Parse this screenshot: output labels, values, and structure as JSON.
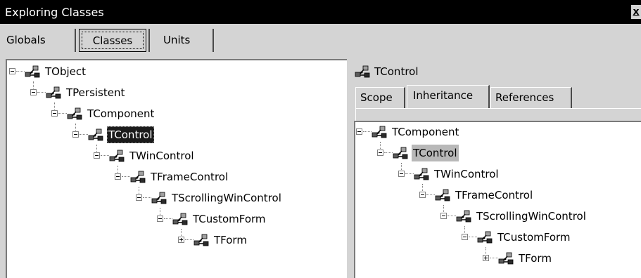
{
  "window": {
    "title": "Exploring Classes",
    "close_label": "x"
  },
  "main_tabs": [
    {
      "label": "Globals"
    },
    {
      "label": "Classes"
    },
    {
      "label": "Units"
    }
  ],
  "left_tree": [
    {
      "label": "TObject"
    },
    {
      "label": "TPersistent"
    },
    {
      "label": "TComponent"
    },
    {
      "label": "TControl"
    },
    {
      "label": "TWinControl"
    },
    {
      "label": "TFrameControl"
    },
    {
      "label": "TScrollingWinControl"
    },
    {
      "label": "TCustomForm"
    },
    {
      "label": "TForm"
    }
  ],
  "selected_class": {
    "label": "TControl"
  },
  "detail_tabs": [
    {
      "label": "Scope"
    },
    {
      "label": "Inheritance"
    },
    {
      "label": "References"
    }
  ],
  "right_tree": [
    {
      "label": "TComponent"
    },
    {
      "label": "TControl"
    },
    {
      "label": "TWinControl"
    },
    {
      "label": "TFrameControl"
    },
    {
      "label": "TScrollingWinControl"
    },
    {
      "label": "TCustomForm"
    },
    {
      "label": "TForm"
    }
  ],
  "icons": {
    "class_icon": "class-node-icon",
    "expand": "expand-icon",
    "collapse": "collapse-icon"
  }
}
